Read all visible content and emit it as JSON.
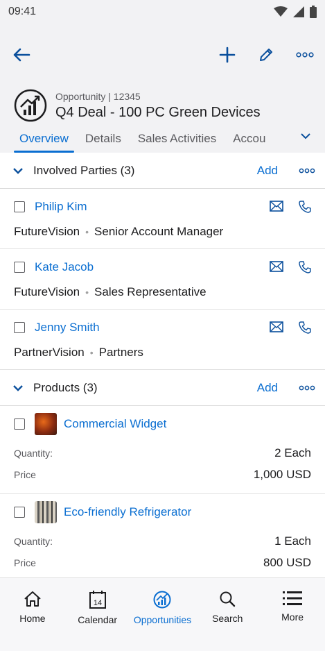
{
  "status": {
    "time": "09:41"
  },
  "object": {
    "subtitle": "Opportunity | 12345",
    "title": "Q4 Deal - 100 PC Green Devices"
  },
  "tabs": [
    "Overview",
    "Details",
    "Sales Activities",
    "Accou"
  ],
  "involved_parties": {
    "title": "Involved Parties (3)",
    "add_label": "Add",
    "items": [
      {
        "name": "Philip Kim",
        "company": "FutureVision",
        "role": "Senior Account Manager"
      },
      {
        "name": "Kate Jacob",
        "company": "FutureVision",
        "role": "Sales Representative"
      },
      {
        "name": "Jenny Smith",
        "company": "PartnerVision",
        "role": "Partners"
      }
    ]
  },
  "products": {
    "title": "Products (3)",
    "add_label": "Add",
    "quantity_label": "Quantity:",
    "price_label": "Price",
    "items": [
      {
        "name": "Commercial Widget",
        "quantity": "2 Each",
        "price": "1,000 USD"
      },
      {
        "name": "Eco-friendly Refrigerator",
        "quantity": "1 Each",
        "price": "800 USD"
      }
    ]
  },
  "nav": {
    "items": [
      {
        "label": "Home",
        "icon": "home-icon"
      },
      {
        "label": "Calendar",
        "icon": "calendar-icon",
        "day": "14"
      },
      {
        "label": "Opportunities",
        "icon": "opportunities-icon"
      },
      {
        "label": "Search",
        "icon": "search-icon"
      },
      {
        "label": "More",
        "icon": "menu-icon"
      }
    ],
    "active": "Opportunities"
  },
  "colors": {
    "accent": "#0a6ed1",
    "header_bg": "#f2f2f4"
  }
}
